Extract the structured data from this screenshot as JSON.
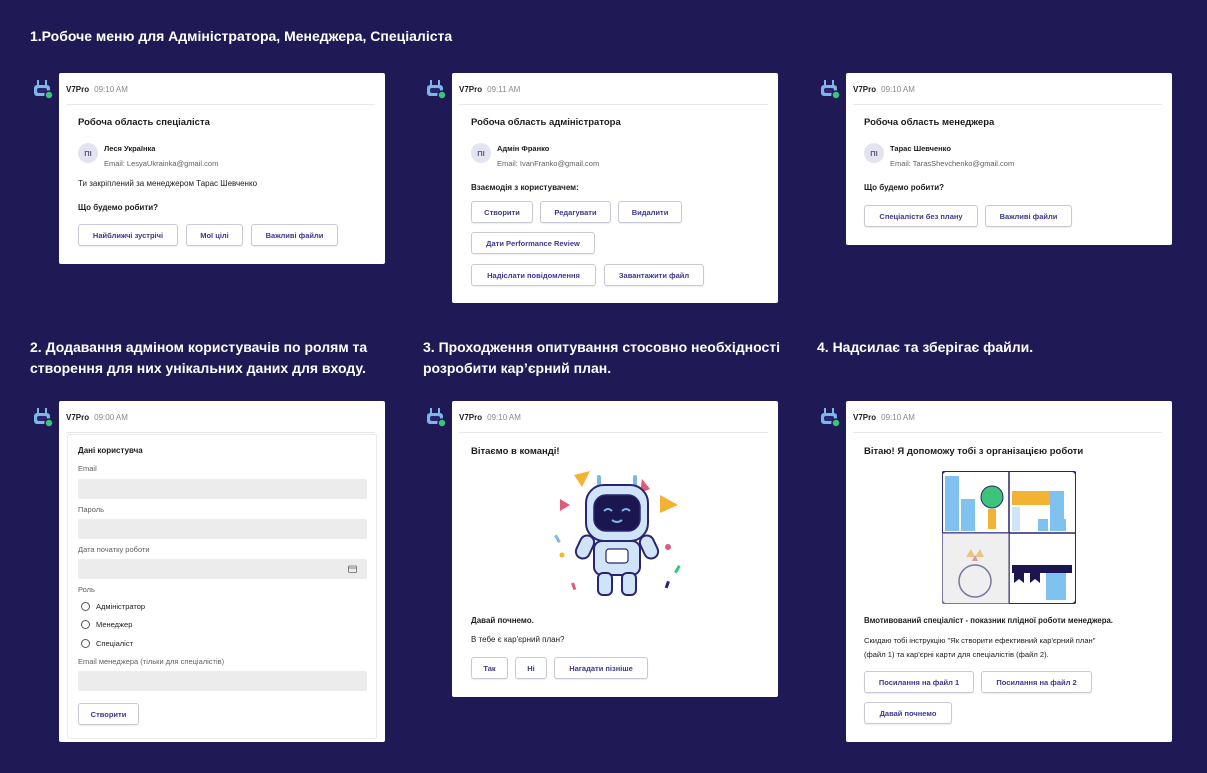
{
  "sections": {
    "s1": "1.Робоче меню для Адміністратора, Менеджера, Спеціаліста",
    "s2_line1": "2. Додавання адміном користувачів по ролям та",
    "s2_line2": "створення для них унікальних даних для входу.",
    "s3_line1": "3. Проходження опитування стосовно необхідності",
    "s3_line2": "розробити кар’єрний план.",
    "s4": "4. Надсилає та зберігає файли."
  },
  "app_name": "V7Pro",
  "colors": {
    "background": "#1f1a55",
    "accent": "#3b3a8f",
    "online": "#3ec47a"
  },
  "card_specialist": {
    "time": "09:10 AM",
    "title": "Робоча область спеціаліста",
    "initials": "ПІ",
    "name": "Леся Українка",
    "email": "Email: LesyaUkrainka@gmail.com",
    "assigned": "Ти закріплений за менеджером Тарас Шевченко",
    "question": "Що будемо робити?",
    "buttons": [
      "Найближчі зустрічі",
      "Мої цілі",
      "Важливі файли"
    ]
  },
  "card_admin": {
    "time": "09:11 AM",
    "title": "Робоча область адміністратора",
    "initials": "ПІ",
    "name": "Адмін Франко",
    "email": "Email: IvanFranko@gmail.com",
    "interaction": "Взаємодія з користувачем:",
    "buttons": [
      "Створити",
      "Редагувати",
      "Видалити",
      "Дати Performance Review",
      "Надіслати повідомлення",
      "Завантажити файл"
    ]
  },
  "card_manager": {
    "time": "09:10 AM",
    "title": "Робоча область менеджера",
    "initials": "ПІ",
    "name": "Тарас Шевченко",
    "email": "Email: TarasShevchenko@gmail.com",
    "question": "Що будемо робити?",
    "buttons": [
      "Спеціалісти без плану",
      "Важливі файли"
    ]
  },
  "card_form": {
    "time": "09:00 AM",
    "title": "Дані користувча",
    "email_label": "Email",
    "password_label": "Пароль",
    "start_date_label": "Дата початку роботи",
    "role_label": "Роль",
    "roles": [
      "Адміністратор",
      "Менеджер",
      "Спеціаліст"
    ],
    "manager_email_label": "Email менеджера (тільки для спеціалістів)",
    "submit": "Створити"
  },
  "card_survey": {
    "time": "09:10 AM",
    "title": "Вітаємо в команді!",
    "start": "Давай почнемо.",
    "question": "В тебе є кар'єрний план?",
    "buttons": [
      "Так",
      "Ні",
      "Нагадати пізніше"
    ]
  },
  "card_files": {
    "time": "09:10 AM",
    "title": "Вітаю! Я допоможу тобі з організацією роботи",
    "motivated": "Вмотивований спеціаліст - показник плідної роботи менеджера.",
    "instruction_line1": "Скидаю тобі інструкцію \"Як створити ефективний кар'єрний план\"",
    "instruction_line2": "(файл 1)  та кар'єрні карти для спеціалістів (файл 2).",
    "buttons": [
      "Посилання на файл 1",
      "Посилання на файл 2",
      "Давай почнемо"
    ]
  }
}
